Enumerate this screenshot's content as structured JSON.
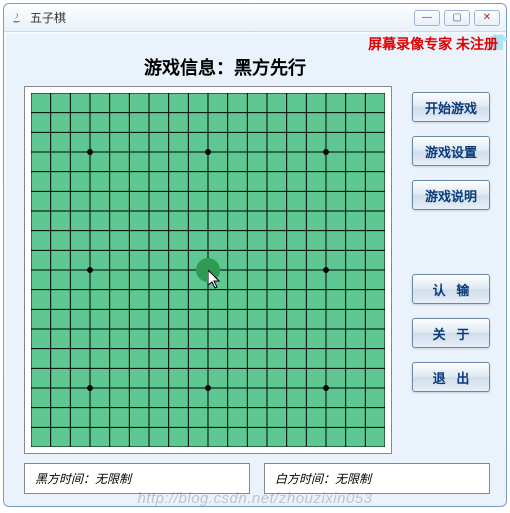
{
  "window": {
    "title": "五子棋"
  },
  "overlay": "屏幕录像专家 未注册",
  "game_info": "游戏信息：黑方先行",
  "buttons": {
    "start": "开始游戏",
    "settings": "游戏设置",
    "help": "游戏说明",
    "resign": "认   输",
    "about": "关   于",
    "exit": "退   出"
  },
  "timers": {
    "black": "黑方时间：无限制",
    "white": "白方时间：无限制"
  },
  "board": {
    "size": 19,
    "star_points": [
      [
        3,
        3
      ],
      [
        3,
        9
      ],
      [
        3,
        15
      ],
      [
        9,
        3
      ],
      [
        9,
        9
      ],
      [
        9,
        15
      ],
      [
        15,
        3
      ],
      [
        15,
        9
      ],
      [
        15,
        15
      ]
    ]
  },
  "watermark": "http://blog.csdn.net/zhouzixin053"
}
